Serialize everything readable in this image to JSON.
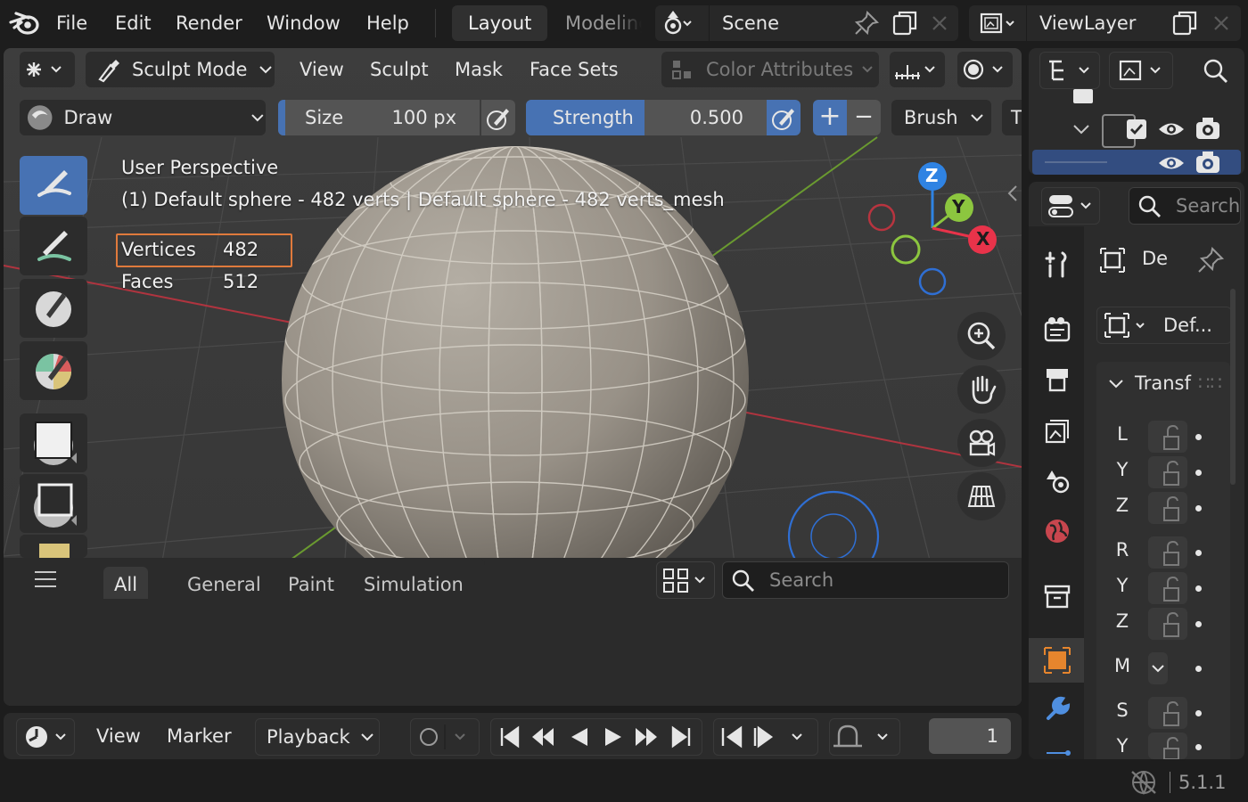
{
  "menubar": {
    "items": [
      "File",
      "Edit",
      "Render",
      "Window",
      "Help"
    ],
    "workspace_active": "Layout",
    "workspace_next": "Modeling",
    "scene_name": "Scene",
    "view_layer": "ViewLayer"
  },
  "viewport_header": {
    "mode": "Sculpt Mode",
    "menus": [
      "View",
      "Sculpt",
      "Mask",
      "Face Sets"
    ],
    "color_attributes": "Color Attributes"
  },
  "tool_settings": {
    "brush_name": "Draw",
    "size_label": "Size",
    "size_value": "100 px",
    "strength_label": "Strength",
    "strength_value": "0.500",
    "plus": "+",
    "minus": "−",
    "brush_menu": "Brush",
    "truncated": "T"
  },
  "overlay": {
    "view_name": "User Perspective",
    "object_info": "(1) Default sphere - 482 verts | Default sphere - 482 verts_mesh",
    "stats": [
      {
        "label": "Vertices",
        "value": "482"
      },
      {
        "label": "Faces",
        "value": "512"
      }
    ]
  },
  "gizmo": {
    "x": "X",
    "y": "Y",
    "z": "Z"
  },
  "asset_bar": {
    "tabs": [
      "All",
      "General",
      "Paint",
      "Simulation"
    ],
    "active_tab": "All",
    "search_placeholder": "Search"
  },
  "timeline": {
    "menus": [
      "View",
      "Marker"
    ],
    "playback": "Playback",
    "frame": "1"
  },
  "outliner": {},
  "properties": {
    "search_placeholder": "Search",
    "object_name": "De",
    "data_name": "Def...",
    "panel_title": "Transf",
    "axis_rows": [
      {
        "label": "L"
      },
      {
        "label": "Y"
      },
      {
        "label": "Z"
      },
      {
        "label": "R"
      },
      {
        "label": "Y"
      },
      {
        "label": "Z"
      },
      {
        "label": "M"
      },
      {
        "label": "S"
      },
      {
        "label": "Y"
      }
    ]
  },
  "status": {
    "version": "5.1.1"
  },
  "colors": {
    "accent": "#4772b3",
    "stats_highlight": "#e07a3c",
    "axis_x": "#e8334a",
    "axis_y": "#8cc63f",
    "axis_z": "#2f83e3"
  }
}
